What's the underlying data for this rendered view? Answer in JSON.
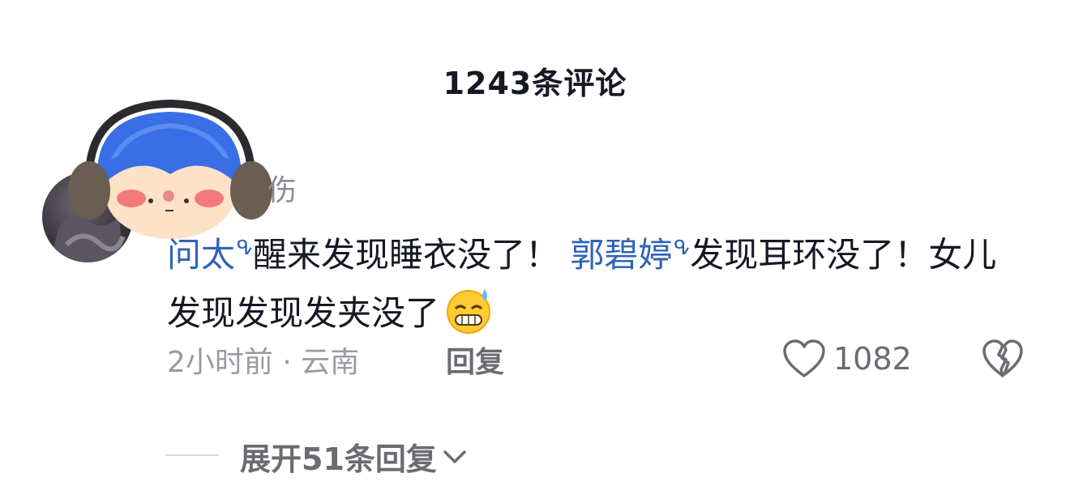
{
  "header": {
    "title": "1243条评论"
  },
  "comment": {
    "username": "伤",
    "text_parts": [
      {
        "type": "mention",
        "text": "问太"
      },
      {
        "type": "text",
        "text": "醒来发现睡衣没了！"
      },
      {
        "type": "mention",
        "text": "郭碧婷"
      },
      {
        "type": "text",
        "text": "发现耳环没了！女儿发现发现发夹没了"
      }
    ],
    "time": "2小时前",
    "separator": "·",
    "location": "云南",
    "reply_label": "回复",
    "like_count": "1082"
  },
  "replies": {
    "expand_label": "展开51条回复"
  },
  "icons": {
    "mention": "search-small-icon",
    "like": "heart-outline-icon",
    "dislike": "broken-heart-icon",
    "expand": "chevron-down-icon",
    "emoji": "grinning-sweat-emoji"
  },
  "colors": {
    "mention": "#2f64b8",
    "text": "#161823",
    "secondary": "#9a9ba1"
  }
}
